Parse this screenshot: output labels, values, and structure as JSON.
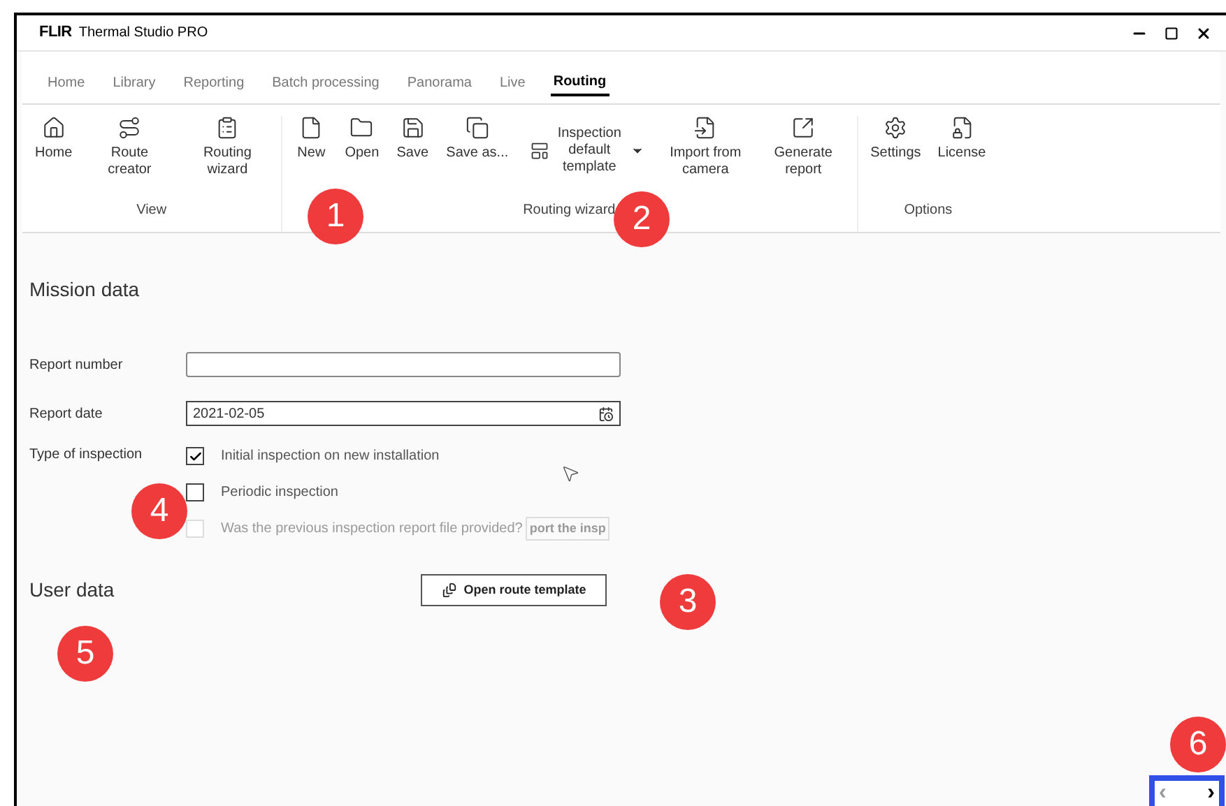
{
  "window": {
    "logo": "FLIR",
    "title": "Thermal Studio PRO"
  },
  "tabs": [
    {
      "label": "Home",
      "selected": false
    },
    {
      "label": "Library",
      "selected": false
    },
    {
      "label": "Reporting",
      "selected": false
    },
    {
      "label": "Batch processing",
      "selected": false
    },
    {
      "label": "Panorama",
      "selected": false
    },
    {
      "label": "Live",
      "selected": false
    },
    {
      "label": "Routing",
      "selected": true
    }
  ],
  "ribbon_groups": [
    {
      "label": "View",
      "items": [
        {
          "kind": "button",
          "label": "Home"
        },
        {
          "kind": "button",
          "label": "Route creator"
        },
        {
          "kind": "button",
          "label": "Routing wizard"
        }
      ]
    },
    {
      "label": "Routing wizard",
      "items": [
        {
          "kind": "button",
          "label": "New"
        },
        {
          "kind": "button",
          "label": "Open"
        },
        {
          "kind": "button",
          "label": "Save"
        },
        {
          "kind": "button",
          "label": "Save as..."
        },
        {
          "kind": "dropdown",
          "label": "Inspection default template"
        },
        {
          "kind": "button",
          "label": "Import from camera"
        },
        {
          "kind": "button",
          "label": "Generate report"
        }
      ]
    },
    {
      "label": "Options",
      "items": [
        {
          "kind": "button",
          "label": "Settings"
        },
        {
          "kind": "button",
          "label": "License"
        }
      ]
    }
  ],
  "mission_data": {
    "title": "Mission data",
    "report_number": {
      "label": "Report number"
    },
    "report_date": {
      "label": "Report date",
      "value": "2021-02-05"
    },
    "type_of_inspection": {
      "label": "Type of inspection",
      "options": [
        {
          "label": "Initial inspection on new installation",
          "checked": true,
          "disabled": false
        },
        {
          "label": "Periodic inspection",
          "checked": false,
          "disabled": false
        },
        {
          "label": "Was the previous inspection report file provided?",
          "checked": false,
          "disabled": true,
          "field_value": "port the insp"
        }
      ]
    }
  },
  "user_data": {
    "title": "User data"
  },
  "open_route_template_button": "Open route template",
  "callouts": [
    "1",
    "2",
    "3",
    "4",
    "5",
    "6"
  ],
  "pager": {
    "prev": "‹",
    "prev_disabled": true,
    "next": "›"
  }
}
